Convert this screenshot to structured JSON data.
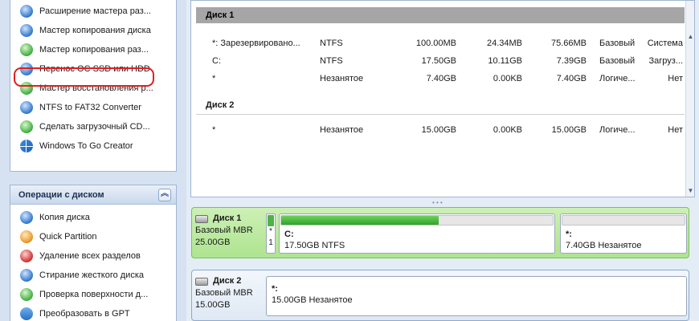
{
  "wizards": {
    "items": [
      {
        "label": "Расширение мастера раз...",
        "icon": "partition-extend-icon"
      },
      {
        "label": "Мастер копирования диска",
        "icon": "disk-copy-icon"
      },
      {
        "label": "Мастер копирования раз...",
        "icon": "partition-copy-icon"
      },
      {
        "label": "Перенос ОС SSD или HDD",
        "icon": "migrate-os-icon"
      },
      {
        "label": "Мастер восстановления р...",
        "icon": "partition-recovery-icon"
      },
      {
        "label": "NTFS to FAT32 Converter",
        "icon": "ntfs-fat32-icon"
      },
      {
        "label": "Сделать загрузочный CD...",
        "icon": "bootable-cd-icon"
      },
      {
        "label": "Windows To Go Creator",
        "icon": "windows-icon"
      }
    ]
  },
  "disk_ops": {
    "header": "Операции с диском",
    "collapse_glyph": "︽",
    "items": [
      {
        "label": "Копия диска",
        "icon": "disk-copy-icon"
      },
      {
        "label": "Quick Partition",
        "icon": "quick-partition-icon"
      },
      {
        "label": "Удаление всех разделов",
        "icon": "delete-partitions-icon"
      },
      {
        "label": "Стирание жесткого диска",
        "icon": "wipe-disk-icon"
      },
      {
        "label": "Проверка поверхности д...",
        "icon": "surface-test-icon"
      },
      {
        "label": "Преобразовать в GPT",
        "icon": "convert-gpt-icon"
      }
    ]
  },
  "disk_list": {
    "disks": [
      {
        "title": "Диск 1",
        "partitions": [
          {
            "name": "*: Зарезервировано...",
            "fs": "NTFS",
            "capacity": "100.00MB",
            "used": "24.34MB",
            "free": "75.66MB",
            "type": "Базовый",
            "status": "Система"
          },
          {
            "name": "C:",
            "fs": "NTFS",
            "capacity": "17.50GB",
            "used": "10.11GB",
            "free": "7.39GB",
            "type": "Базовый",
            "status": "Загруз..."
          },
          {
            "name": "*",
            "fs": "Незанятое",
            "capacity": "7.40GB",
            "used": "0.00KB",
            "free": "7.40GB",
            "type": "Логиче...",
            "status": "Нет"
          }
        ]
      },
      {
        "title": "Диск 2",
        "partitions": [
          {
            "name": "*",
            "fs": "Незанятое",
            "capacity": "15.00GB",
            "used": "0.00KB",
            "free": "15.00GB",
            "type": "Логиче...",
            "status": "Нет"
          }
        ]
      }
    ]
  },
  "disk_map": {
    "disk1": {
      "title": "Диск 1",
      "type": "Базовый MBR",
      "size": "25.00GB",
      "mini_label_top": "*",
      "mini_label_bottom": "1",
      "p1_label": "C:",
      "p1_desc": "17.50GB NTFS",
      "p1_used_fraction": 0.58,
      "p2_label": "*:",
      "p2_desc": "7.40GB Незанятое",
      "p2_used_fraction": 0
    },
    "disk2": {
      "title": "Диск 2",
      "type": "Базовый MBR",
      "size": "15.00GB",
      "p1_label": "*:",
      "p1_desc": "15.00GB Незанятое"
    }
  },
  "colors": {
    "highlight_ring": "#e02020",
    "selected_disk_bg": "#aee48f",
    "used_bar": "#2ea32a",
    "disk_band": "#a6a6a6"
  }
}
